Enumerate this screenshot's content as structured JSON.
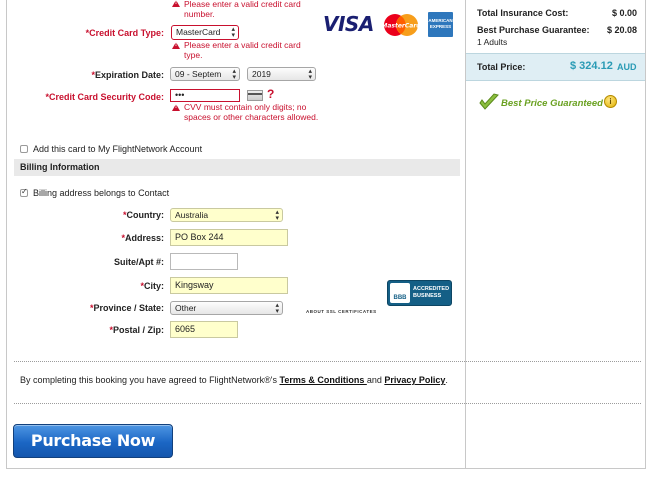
{
  "card_errors": {
    "number_error": "Please enter a valid credit card number.",
    "type_error": "Please enter a valid credit card type.",
    "cvv_error": "CVV must contain only digits; no spaces or other characters allowed."
  },
  "card": {
    "type_label": "Credit Card Type:",
    "type_value": "MasterCard",
    "expiration_label": "Expiration Date:",
    "exp_month_value": "09 - Septem",
    "exp_year_value": "2019",
    "cvv_label": "*Credit Card Security Code:",
    "cvv_value": "•••",
    "cvv_help": "?",
    "brands": {
      "visa": "VISA",
      "mastercard": "MasterCard",
      "amex": "AMERICAN EXPRESS"
    }
  },
  "save_card": {
    "label": "Add this card to My FlightNetwork Account",
    "checked": false
  },
  "billing": {
    "section_title": "Billing Information",
    "same_as_contact_label": "Billing address belongs to Contact",
    "same_as_contact_checked": true,
    "country_label": "Country:",
    "country_value": "Australia",
    "address_label": "Address:",
    "address_value": "PO Box 244",
    "suite_label": "Suite/Apt #:",
    "suite_value": "",
    "city_label": "City:",
    "city_value": "Kingsway",
    "province_label": "Province / State:",
    "province_value": "Other",
    "postal_label": "Postal / Zip:",
    "postal_value": "6065"
  },
  "badges": {
    "bbb_line1": "ACCREDITED",
    "bbb_line2": "BUSINESS",
    "bbb_logo": "BBB",
    "ssl_text": "ABOUT SSL CERTIFICATES"
  },
  "terms": {
    "prefix": "By completing this booking you have agreed to FlightNetwork®'s ",
    "terms_link": "Terms & Conditions ",
    "and": "and ",
    "privacy_link": "Privacy Policy",
    "suffix": "."
  },
  "purchase_button": "Purchase Now",
  "summary": {
    "insurance_label": "Total Insurance Cost:",
    "insurance_value": "$ 0.00",
    "guarantee_label": "Best Purchase Guarantee:",
    "guarantee_value": "$ 20.08",
    "adults": "1 Adults",
    "total_label": "Total Price:",
    "total_value": "$ 324.12",
    "currency": "AUD",
    "best_price": "Best Price Guaranteed",
    "info_icon": "i"
  },
  "colors": {
    "error_red": "#c8102e",
    "button_blue": "#1b66c4",
    "total_teal": "#2a9bb5",
    "best_price_green": "#6aa121"
  }
}
